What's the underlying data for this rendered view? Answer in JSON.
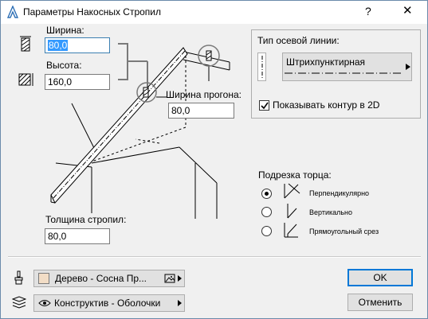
{
  "window": {
    "title": "Параметры Накосных Стропил",
    "help_glyph": "?",
    "close_glyph": "✕"
  },
  "left": {
    "width_label": "Ширина:",
    "width_value": "80,0",
    "height_label": "Высота:",
    "height_value": "160,0"
  },
  "diagram": {
    "purlin_width_label": "Ширина прогона:",
    "purlin_width_value": "80,0",
    "rafter_thickness_label": "Толщина стропил:",
    "rafter_thickness_value": "80,0"
  },
  "axis_line": {
    "group_label": "Тип осевой линии:",
    "linetype_name": "Штрихпунктирная",
    "show_contour_label": "Показывать контур в 2D",
    "show_contour_checked": true
  },
  "end_cut": {
    "label": "Подрезка торца:",
    "options": [
      "Перпендикулярно",
      "Вертикально",
      "Прямоугольный срез"
    ],
    "selected_index": 0
  },
  "footer": {
    "material": "Дерево - Сосна Пр...",
    "material_swatch_color": "#f2ddc6",
    "layer": "Конструктив - Оболочки",
    "ok_label": "OK",
    "cancel_label": "Отменить"
  }
}
